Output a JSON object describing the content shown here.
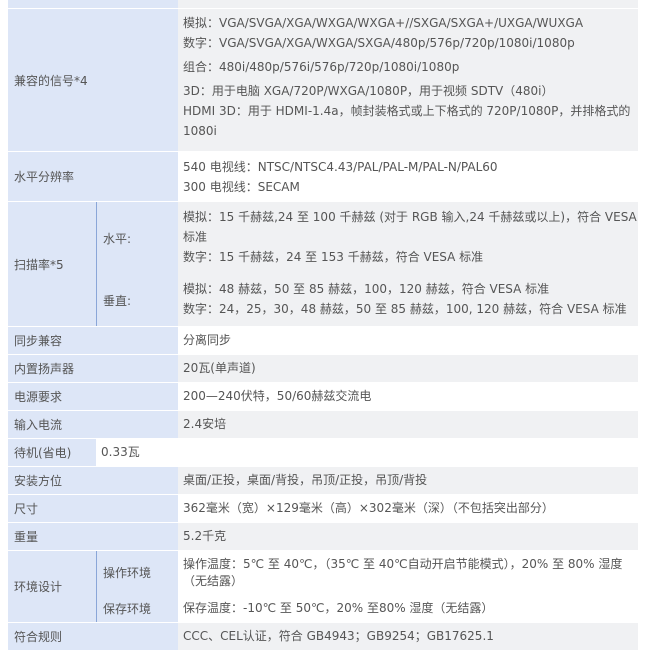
{
  "rows": {
    "signal": {
      "label": "兼容的信号*4",
      "lines": [
        "模拟：VGA/SVGA/XGA/WXGA/WXGA+//SXGA/SXGA+/UXGA/WUXGA",
        "数字：VGA/SVGA/XGA/WXGA/SXGA/480p/576p/720p/1080i/1080p",
        "组合：480i/480p/576i/576p/720p/1080i/1080p",
        "3D：用于电脑 XGA/720P/WXGA/1080P，用于视频 SDTV（480i）",
        "HDMI 3D：用于 HDMI-1.4a，帧封装格式或上下格式的 720P/1080P，并排格式的",
        "1080i"
      ]
    },
    "hres": {
      "label": "水平分辨率",
      "lines": [
        "540 电视线：NTSC/NTSC4.43/PAL/PAL-M/PAL-N/PAL60",
        "300 电视线：SECAM"
      ]
    },
    "scan": {
      "label": "扫描率*5",
      "h_label": "水平:",
      "h_lines": [
        "模拟：15 千赫兹,24 至 100 千赫兹 (对于 RGB 输入,24 千赫兹或以上)，符合 VESA",
        "标准",
        "数字：15 千赫兹，24 至 153 千赫兹，符合 VESA 标准"
      ],
      "v_label": "垂直:",
      "v_lines": [
        "模拟：48 赫兹，50 至 85 赫兹，100，120 赫兹，符合 VESA 标准",
        "数字：24，25，30，48 赫兹，50 至 85 赫兹，100, 120 赫兹，符合 VESA 标准"
      ]
    },
    "sync": {
      "label": "同步兼容",
      "value": "分离同步"
    },
    "speaker": {
      "label": "内置扬声器",
      "value": "20瓦(单声道)"
    },
    "power": {
      "label": "电源要求",
      "value": "200—240伏特，50/60赫兹交流电"
    },
    "current": {
      "label": "输入电流",
      "value": "2.4安培"
    },
    "standby": {
      "label": "待机(省电)",
      "value": "0.33瓦"
    },
    "mount": {
      "label": "安装方位",
      "value": "桌面/正投，桌面/背投，吊顶/正投，吊顶/背投"
    },
    "size": {
      "label": "尺寸",
      "value": "362毫米（宽）×129毫米（高）×302毫米（深）（不包括突出部分）"
    },
    "weight": {
      "label": "重量",
      "value": "5.2千克"
    },
    "env": {
      "label": "环境设计",
      "op_label": "操作环境",
      "op_lines": [
        "操作温度：5℃ 至 40℃，（35℃ 至 40℃自动开启节能模式），20% 至 80% 湿度",
        "（无结露）"
      ],
      "st_label": "保存环境",
      "st_value": "保存温度：-10℃ 至 50℃，20% 至80% 湿度（无结露）"
    },
    "compliance": {
      "label": "符合规则",
      "value": "CCC、CEL认证，符合 GB4943；GB9254；GB17625.1"
    }
  }
}
